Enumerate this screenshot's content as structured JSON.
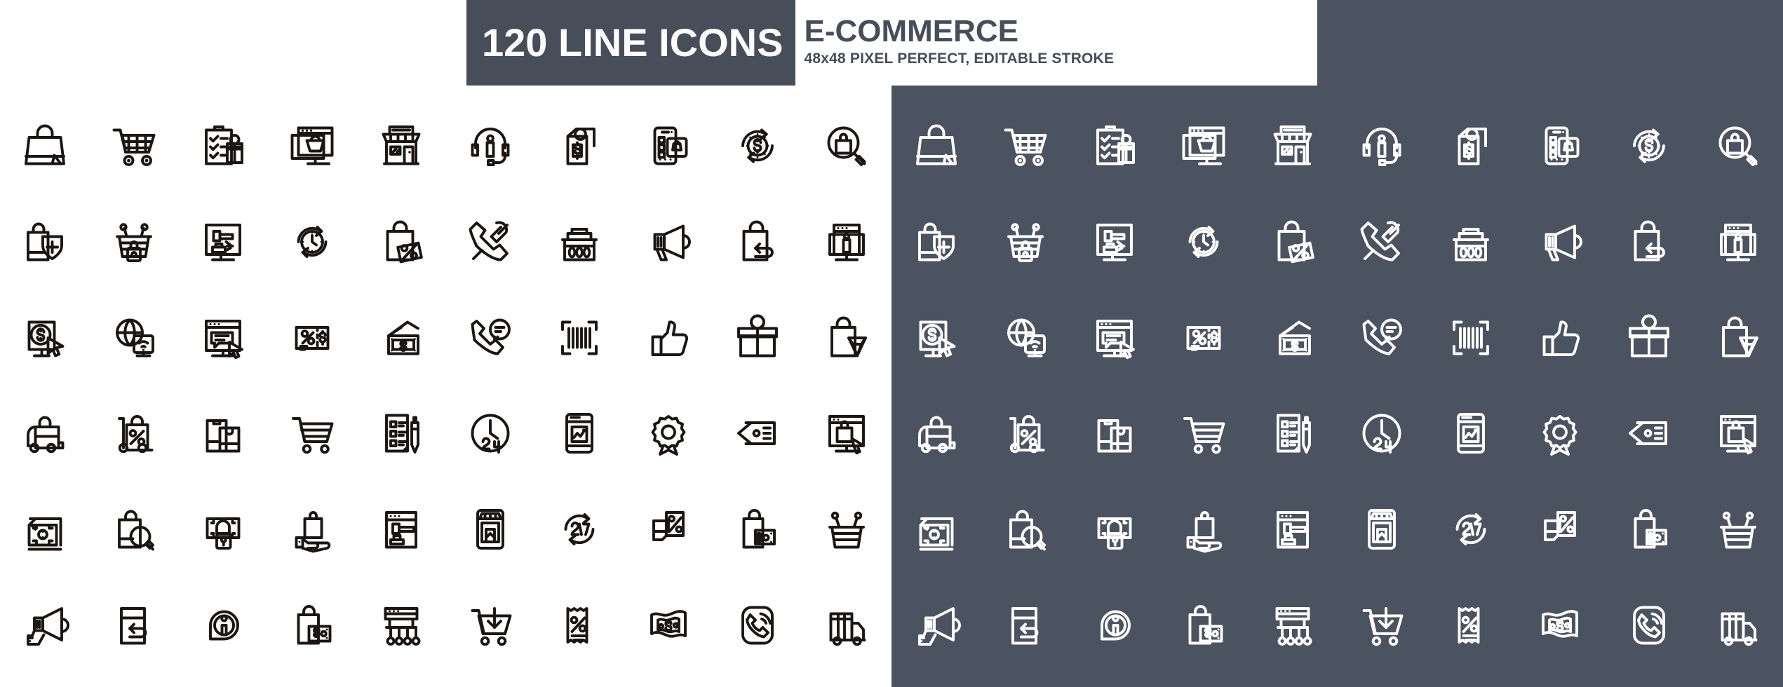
{
  "meta": {
    "collection_title": "120 LINE ICONS",
    "category_title": "E-COMMERCE",
    "spec_line": "48x48 PIXEL PERFECT, EDITABLE STROKE",
    "icon_count": 120,
    "grid_columns": 10,
    "grid_rows": 6,
    "unique_icons": 60,
    "colors": {
      "dark_panel_bg": "#4b5360",
      "header_block_bg": "#474e5a",
      "light_panel_bg": "#ffffff",
      "light_stroke": "#1b1613",
      "dark_stroke": "#ffffff",
      "header_text_light": "#fdfdfd",
      "header_text_dark": "#474e5a"
    }
  },
  "panels": [
    {
      "id": "light-panel",
      "label": "Light variant icon set",
      "background": "#ffffff",
      "stroke": "#1b1613"
    },
    {
      "id": "dark-panel",
      "label": "Dark variant icon set",
      "background": "#4b5360",
      "stroke": "#ffffff"
    }
  ],
  "icons": [
    {
      "name": "shopping-bag-icon",
      "label": "Shopping Bag"
    },
    {
      "name": "shopping-cart-icon",
      "label": "Shopping Cart"
    },
    {
      "name": "checklist-gift-icon",
      "label": "Wish List"
    },
    {
      "name": "online-store-monitor-icon",
      "label": "Online Store"
    },
    {
      "name": "storefront-icon",
      "label": "Retail Store"
    },
    {
      "name": "headset-support-icon",
      "label": "Customer Support"
    },
    {
      "name": "price-tag-dollar-icon",
      "label": "Price Tag"
    },
    {
      "name": "mobile-shopping-app-icon",
      "label": "Mobile Shopping"
    },
    {
      "name": "money-refund-circle-icon",
      "label": "Money Back"
    },
    {
      "name": "product-search-magnifier-icon",
      "label": "Product Search"
    },
    {
      "name": "bag-shield-protection-icon",
      "label": "Purchase Protection"
    },
    {
      "name": "secure-basket-lock-icon",
      "label": "Secure Basket"
    },
    {
      "name": "online-auction-monitor-icon",
      "label": "Online Auction"
    },
    {
      "name": "clock-refresh-icon",
      "label": "Fast Delivery Time"
    },
    {
      "name": "discount-bag-percent-icon",
      "label": "Discount Bag"
    },
    {
      "name": "phone-support-wrench-icon",
      "label": "Technical Support"
    },
    {
      "name": "shopping-basket-icon",
      "label": "Shopping Basket"
    },
    {
      "name": "megaphone-marketing-icon",
      "label": "Marketing"
    },
    {
      "name": "return-bag-arrow-icon",
      "label": "Product Return"
    },
    {
      "name": "product-info-monitor-icon",
      "label": "Product Information"
    },
    {
      "name": "pay-per-click-icon",
      "label": "Pay Per Click"
    },
    {
      "name": "global-wifi-commerce-icon",
      "label": "Global E-Commerce"
    },
    {
      "name": "online-chat-monitor-icon",
      "label": "Live Chat"
    },
    {
      "name": "discount-coupon-icon",
      "label": "Discount Coupon"
    },
    {
      "name": "money-wallet-icon",
      "label": "Wallet"
    },
    {
      "name": "phone-call-support-icon",
      "label": "Call Support"
    },
    {
      "name": "barcode-scan-icon",
      "label": "Barcode Scan"
    },
    {
      "name": "thumbs-up-review-icon",
      "label": "Positive Review"
    },
    {
      "name": "gift-box-icon",
      "label": "Gift Box"
    },
    {
      "name": "premium-bag-diamond-icon",
      "label": "Premium Product"
    },
    {
      "name": "delivery-truck-bag-icon",
      "label": "Bag Delivery"
    },
    {
      "name": "hand-truck-discount-icon",
      "label": "Discount Shipping"
    },
    {
      "name": "shopping-bags-pair-icon",
      "label": "Shopping Bags"
    },
    {
      "name": "empty-cart-icon",
      "label": "Empty Cart"
    },
    {
      "name": "order-list-pen-icon",
      "label": "Order Form"
    },
    {
      "name": "clock-24-hours-icon",
      "label": "24 Hours Service"
    },
    {
      "name": "mobile-store-chart-icon",
      "label": "Store Analytics"
    },
    {
      "name": "settings-gear-award-icon",
      "label": "Quality Settings"
    },
    {
      "name": "sale-tags-icon",
      "label": "Sale Tags"
    },
    {
      "name": "verified-product-monitor-icon",
      "label": "Verified Product"
    },
    {
      "name": "money-back-banknote-icon",
      "label": "Money Refund"
    },
    {
      "name": "bag-search-icon",
      "label": "Search Product"
    },
    {
      "name": "secure-payment-lock-icon",
      "label": "Secure Payment"
    },
    {
      "name": "bag-in-hand-icon",
      "label": "Hand Delivery"
    },
    {
      "name": "auction-web-page-icon",
      "label": "Web Auction"
    },
    {
      "name": "store-mobile-front-icon",
      "label": "Mobile Store"
    },
    {
      "name": "24-7-service-icon",
      "label": "24/7 Service"
    },
    {
      "name": "discount-document-icon",
      "label": "Discount Offer"
    },
    {
      "name": "bag-card-payment-icon",
      "label": "Card Payment"
    },
    {
      "name": "shopping-basket-empty-icon",
      "label": "Basket"
    },
    {
      "name": "hand-megaphone-promo-icon",
      "label": "Promotion"
    },
    {
      "name": "return-policy-page-icon",
      "label": "Return Policy"
    },
    {
      "name": "info-support-icon",
      "label": "Information"
    },
    {
      "name": "bag-banknote-icon",
      "label": "Cash Purchase"
    },
    {
      "name": "affiliate-marketing-icon",
      "label": "Affiliate Marketing"
    },
    {
      "name": "add-to-cart-icon",
      "label": "Add To Cart"
    },
    {
      "name": "discount-receipt-icon",
      "label": "Discount Receipt"
    },
    {
      "name": "cash-banknote-icon",
      "label": "Cash"
    },
    {
      "name": "phone-ring-call-icon",
      "label": "Call Center"
    },
    {
      "name": "cargo-delivery-truck-icon",
      "label": "Cargo Delivery"
    }
  ]
}
